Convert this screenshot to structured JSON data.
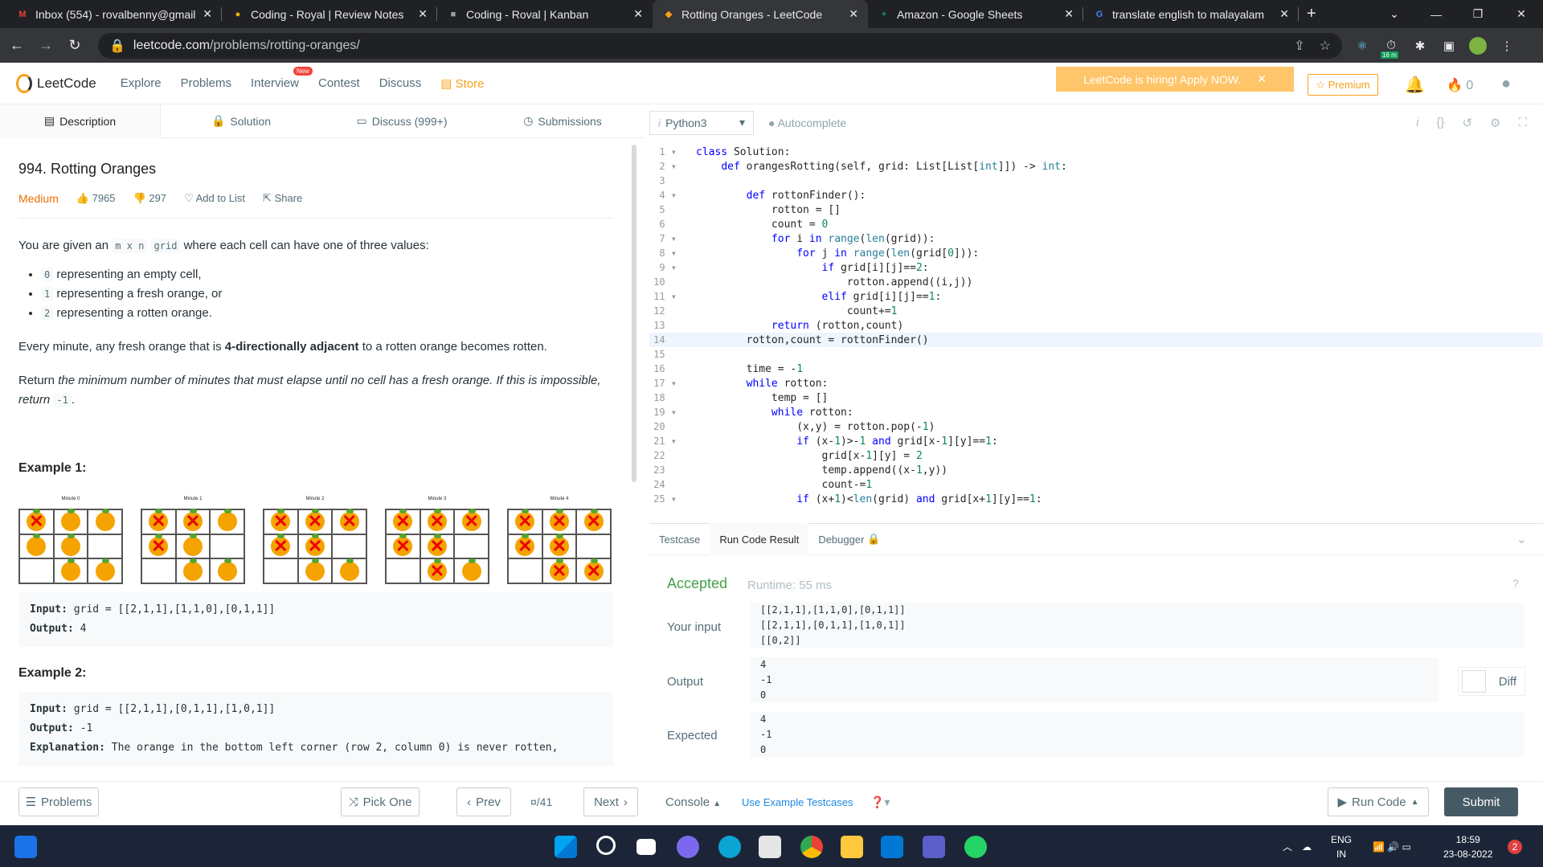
{
  "browser": {
    "tabs": [
      {
        "title": "Inbox (554) - rovalbenny@gmail",
        "icon": "gmail-icon",
        "color": "#ea4335",
        "glyph": "M"
      },
      {
        "title": "Coding - Royal | Review Notes",
        "icon": "avatar-icon",
        "color": "#f4b400",
        "glyph": "●"
      },
      {
        "title": "Coding - Roval | Kanban",
        "icon": "notion-icon",
        "color": "#9aa0a6",
        "glyph": "■"
      },
      {
        "title": "Rotting Oranges - LeetCode",
        "icon": "leetcode-icon",
        "color": "#f89f1b",
        "glyph": "◆"
      },
      {
        "title": "Amazon - Google Sheets",
        "icon": "sheets-icon",
        "color": "#0f9d58",
        "glyph": "+"
      },
      {
        "title": "translate english to malayalam",
        "icon": "google-icon",
        "color": "#4285f4",
        "glyph": "G"
      }
    ],
    "url_host": "leetcode.com",
    "url_path": "/problems/rotting-oranges/",
    "ext_badge": "16 m"
  },
  "lcnav": {
    "logo": "LeetCode",
    "links": [
      "Explore",
      "Problems",
      "Interview",
      "Contest",
      "Discuss"
    ],
    "new_badge": "New",
    "store": "Store",
    "hiring": "LeetCode is hiring! Apply NOW.",
    "premium": "Premium",
    "coins": "0"
  },
  "desc_tabs": [
    "Description",
    "Solution",
    "Discuss (999+)",
    "Submissions"
  ],
  "problem": {
    "title": "994. Rotting Oranges",
    "difficulty": "Medium",
    "likes": "7965",
    "dislikes": "297",
    "add_to_list": "Add to List",
    "share": "Share",
    "intro_pre": "You are given an ",
    "intro_code1": "m x n",
    "intro_code2": "grid",
    "intro_post": " where each cell can have one of three values:",
    "bullets": [
      {
        "code": "0",
        "text": "representing an empty cell,"
      },
      {
        "code": "1",
        "text": "representing a fresh orange, or"
      },
      {
        "code": "2",
        "text": "representing a rotten orange."
      }
    ],
    "p2_pre": "Every minute, any fresh orange that is ",
    "p2_bold": "4-directionally adjacent",
    "p2_post": " to a rotten orange becomes rotten.",
    "p3_pre": "Return ",
    "p3_italic": "the minimum number of minutes that must elapse until no cell has a fresh orange",
    "p3_mid": ". If this is impossible, return ",
    "p3_code": "-1",
    "p3_end": ".",
    "example1_title": "Example 1:",
    "minutes": [
      {
        "caption": "Minute 0",
        "cells": [
          2,
          1,
          1,
          1,
          1,
          0,
          0,
          1,
          1
        ]
      },
      {
        "caption": "Minute 1",
        "cells": [
          2,
          2,
          1,
          2,
          1,
          0,
          0,
          1,
          1
        ]
      },
      {
        "caption": "Minute 2",
        "cells": [
          2,
          2,
          2,
          2,
          2,
          0,
          0,
          1,
          1
        ]
      },
      {
        "caption": "Minute 3",
        "cells": [
          2,
          2,
          2,
          2,
          2,
          0,
          0,
          2,
          1
        ]
      },
      {
        "caption": "Minute 4",
        "cells": [
          2,
          2,
          2,
          2,
          2,
          0,
          0,
          2,
          2
        ]
      }
    ],
    "ex1_input_label": "Input:",
    "ex1_input": "grid = [[2,1,1],[1,1,0],[0,1,1]]",
    "ex1_output_label": "Output:",
    "ex1_output": "4",
    "example2_title": "Example 2:",
    "ex2_input": "grid = [[2,1,1],[0,1,1],[1,0,1]]",
    "ex2_output": "-1",
    "ex2_expl_label": "Explanation:",
    "ex2_expl": "The orange in the bottom left corner (row 2, column 0) is never rotten,"
  },
  "editor": {
    "language": "Python3",
    "autocomplete": "Autocomplete",
    "lines": [
      "class Solution:",
      "    def orangesRotting(self, grid: List[List[int]]) -> int:",
      "",
      "        def rottonFinder():",
      "            rotton = []",
      "            count = 0",
      "            for i in range(len(grid)):",
      "                for j in range(len(grid[0])):",
      "                    if grid[i][j]==2:",
      "                        rotton.append((i,j))",
      "                    elif grid[i][j]==1:",
      "                        count+=1",
      "            return (rotton,count)",
      "        rotton,count = rottonFinder()",
      "",
      "        time = -1",
      "        while rotton:",
      "            temp = []",
      "            while rotton:",
      "                (x,y) = rotton.pop(-1)",
      "                if (x-1)>-1 and grid[x-1][y]==1:",
      "                    grid[x-1][y] = 2",
      "                    temp.append((x-1,y))",
      "                    count-=1",
      "                if (x+1)<len(grid) and grid[x+1][y]==1:"
    ]
  },
  "result": {
    "tabs": [
      "Testcase",
      "Run Code Result",
      "Debugger"
    ],
    "status": "Accepted",
    "runtime": "Runtime: 55 ms",
    "input_label": "Your input",
    "input_lines": [
      "[[2,1,1],[1,1,0],[0,1,1]]",
      "[[2,1,1],[0,1,1],[1,0,1]]",
      "[[0,2]]"
    ],
    "output_label": "Output",
    "output_lines": [
      "4",
      "-1",
      "0"
    ],
    "expected_label": "Expected",
    "expected_lines": [
      "4",
      "-1",
      "0"
    ],
    "diff": "Diff"
  },
  "bottom": {
    "problems": "Problems",
    "pick_one": "Pick One",
    "prev": "Prev",
    "page": "/41",
    "next": "Next",
    "console": "Console",
    "use_example": "Use Example Testcases",
    "run_code": "Run Code",
    "submit": "Submit"
  },
  "taskbar": {
    "lang": "ENG",
    "region": "IN",
    "time": "18:59",
    "date": "23-08-2022",
    "notif": "2"
  }
}
